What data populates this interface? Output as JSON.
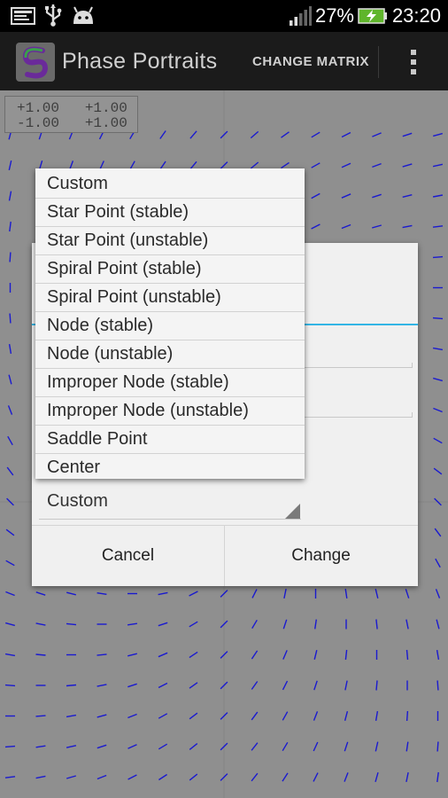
{
  "status_bar": {
    "battery_percent": "27%",
    "time": "23:20",
    "icons": [
      "screenshot-icon",
      "usb-icon",
      "android-icon",
      "signal-icon",
      "battery-charging-icon"
    ]
  },
  "action_bar": {
    "title": "Phase Portraits",
    "change_matrix": "CHANGE MATRIX",
    "overflow_icon": "overflow-menu-icon"
  },
  "matrix_readout": {
    "row1": "+1.00   +1.00",
    "row2": "-1.00   +1.00"
  },
  "dropdown": {
    "items": [
      "Custom",
      "Star Point (stable)",
      "Star Point (unstable)",
      "Spiral Point (stable)",
      "Spiral Point (unstable)",
      "Node (stable)",
      "Node (unstable)",
      "Improper Node (stable)",
      "Improper Node (unstable)",
      "Saddle Point",
      "Center"
    ]
  },
  "dialog": {
    "preset_selected": "Custom",
    "cancel_label": "Cancel",
    "change_label": "Change"
  },
  "colors": {
    "accent": "#33b5e5",
    "vector": "#1a1ad0",
    "background": "#8f8f8f"
  }
}
